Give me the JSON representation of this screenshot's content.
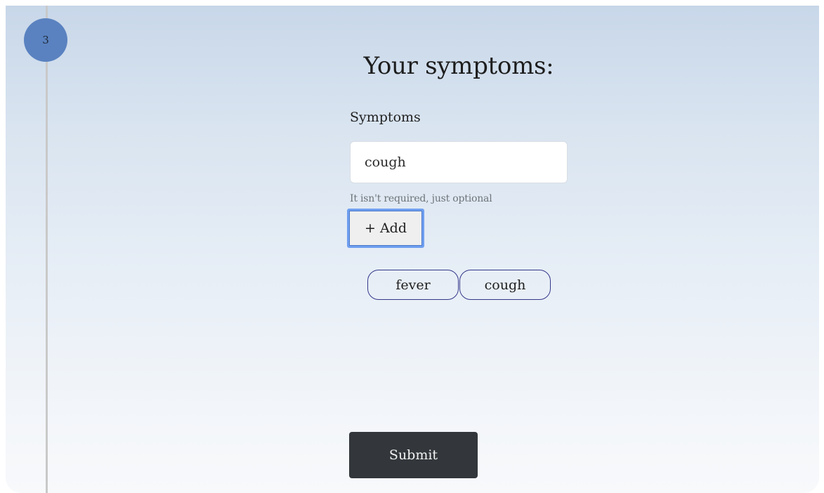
{
  "step": {
    "number": "3"
  },
  "form": {
    "title": "Your symptoms:",
    "field_label": "Symptoms",
    "input_value": "cough",
    "hint": "It isn't required, just optional",
    "add_label": "+ Add",
    "submit_label": "Submit"
  },
  "tags": [
    {
      "label": "fever"
    },
    {
      "label": "cough"
    }
  ],
  "colors": {
    "step_badge": "#5a82c0",
    "tag_border": "#33378a",
    "add_focus_ring": "#6f9ff0",
    "submit_background": "#33373b"
  }
}
